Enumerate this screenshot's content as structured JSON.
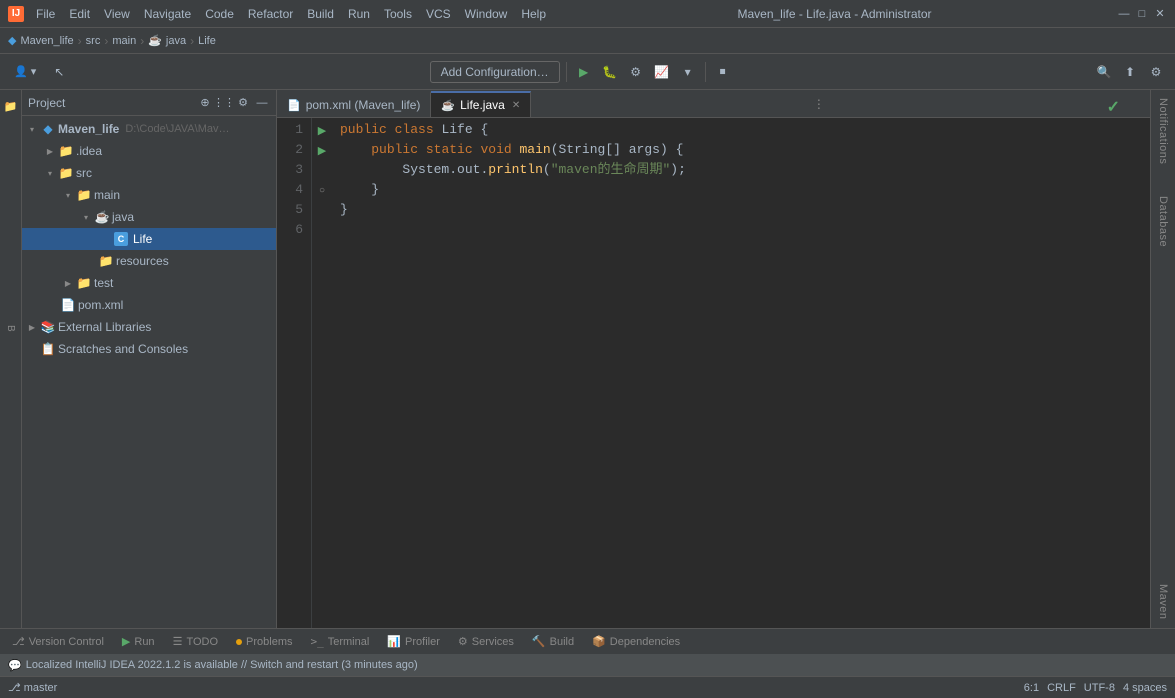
{
  "titlebar": {
    "app_name": "Maven_life",
    "file_name": "Life.java",
    "user": "Administrator",
    "full_title": "Maven_life - Life.java - Administrator",
    "menu": [
      "File",
      "Edit",
      "View",
      "Navigate",
      "Code",
      "Refactor",
      "Build",
      "Run",
      "Tools",
      "VCS",
      "Window",
      "Help"
    ],
    "window_controls": [
      "—",
      "□",
      "✕"
    ]
  },
  "breadcrumb": {
    "items": [
      "Maven_life",
      "src",
      "main",
      "java",
      "Life"
    ]
  },
  "toolbar": {
    "add_config_label": "Add Configuration…",
    "icons": [
      "▶",
      "⏹",
      "⟳",
      "⤓",
      "⚙",
      "🔍",
      "⬆",
      "⚙"
    ]
  },
  "project_panel": {
    "title": "Project",
    "items": [
      {
        "id": "maven_life",
        "label": "Maven_life",
        "path": "D:\\Code\\JAVA\\Mav…",
        "type": "root",
        "indent": 0,
        "expanded": true
      },
      {
        "id": "idea",
        "label": ".idea",
        "type": "folder",
        "indent": 1,
        "expanded": false
      },
      {
        "id": "src",
        "label": "src",
        "type": "folder",
        "indent": 1,
        "expanded": true
      },
      {
        "id": "main",
        "label": "main",
        "type": "folder",
        "indent": 2,
        "expanded": true
      },
      {
        "id": "java",
        "label": "java",
        "type": "folder",
        "indent": 3,
        "expanded": true
      },
      {
        "id": "life",
        "label": "Life",
        "type": "class",
        "indent": 4,
        "selected": true
      },
      {
        "id": "resources",
        "label": "resources",
        "type": "folder",
        "indent": 3
      },
      {
        "id": "test",
        "label": "test",
        "type": "folder",
        "indent": 2,
        "expanded": false
      },
      {
        "id": "pom_xml",
        "label": "pom.xml",
        "type": "pom",
        "indent": 1
      },
      {
        "id": "ext_libs",
        "label": "External Libraries",
        "type": "ext_lib",
        "indent": 0,
        "expandable": true
      },
      {
        "id": "scratches",
        "label": "Scratches and Consoles",
        "type": "scratches",
        "indent": 0
      }
    ]
  },
  "editor": {
    "tabs": [
      {
        "id": "pom_xml",
        "label": "pom.xml (Maven_life)",
        "icon": "📄",
        "active": false
      },
      {
        "id": "life_java",
        "label": "Life.java",
        "icon": "☕",
        "active": true,
        "closeable": true
      }
    ],
    "code_lines": [
      {
        "num": 1,
        "text": "public class Life {"
      },
      {
        "num": 2,
        "text": "    public static void main(String[] args) {"
      },
      {
        "num": 3,
        "text": "        System.out.println(\"maven的生命周期\");"
      },
      {
        "num": 4,
        "text": "    }"
      },
      {
        "num": 5,
        "text": "}"
      },
      {
        "num": 6,
        "text": ""
      }
    ]
  },
  "right_sidebar": {
    "notifications_label": "Notifications",
    "database_label": "Database",
    "maven_label": "Maven"
  },
  "left_sidebar": {
    "icons": [
      "project",
      "bookmark",
      "structure"
    ]
  },
  "bottom_tabs": [
    {
      "id": "version_control",
      "label": "Version Control",
      "icon": "⎇"
    },
    {
      "id": "run",
      "label": "Run",
      "icon": "▶",
      "dot_color": ""
    },
    {
      "id": "todo",
      "label": "TODO",
      "icon": "☰"
    },
    {
      "id": "problems",
      "label": "Problems",
      "icon": "⚠",
      "dot_color": "yellow"
    },
    {
      "id": "terminal",
      "label": "Terminal",
      "icon": ">"
    },
    {
      "id": "profiler",
      "label": "Profiler",
      "icon": "📊"
    },
    {
      "id": "services",
      "label": "Services",
      "icon": "⚙"
    },
    {
      "id": "build",
      "label": "Build",
      "icon": "🔨"
    },
    {
      "id": "dependencies",
      "label": "Dependencies",
      "icon": "📦"
    }
  ],
  "status_bar": {
    "notification": "Localized IntelliJ IDEA 2022.1.2 is available // Switch and restart (3 minutes ago)",
    "cursor_pos": "6:1",
    "line_ending": "CRLF",
    "encoding": "UTF-8",
    "indent": "4 spaces"
  },
  "colors": {
    "accent_blue": "#4a9ede",
    "bg_dark": "#2b2b2b",
    "bg_mid": "#3c3f41",
    "text_main": "#a9b7c6",
    "keyword": "#cc7832",
    "string": "#6a8759",
    "func": "#ffc66d",
    "green": "#59a869"
  }
}
